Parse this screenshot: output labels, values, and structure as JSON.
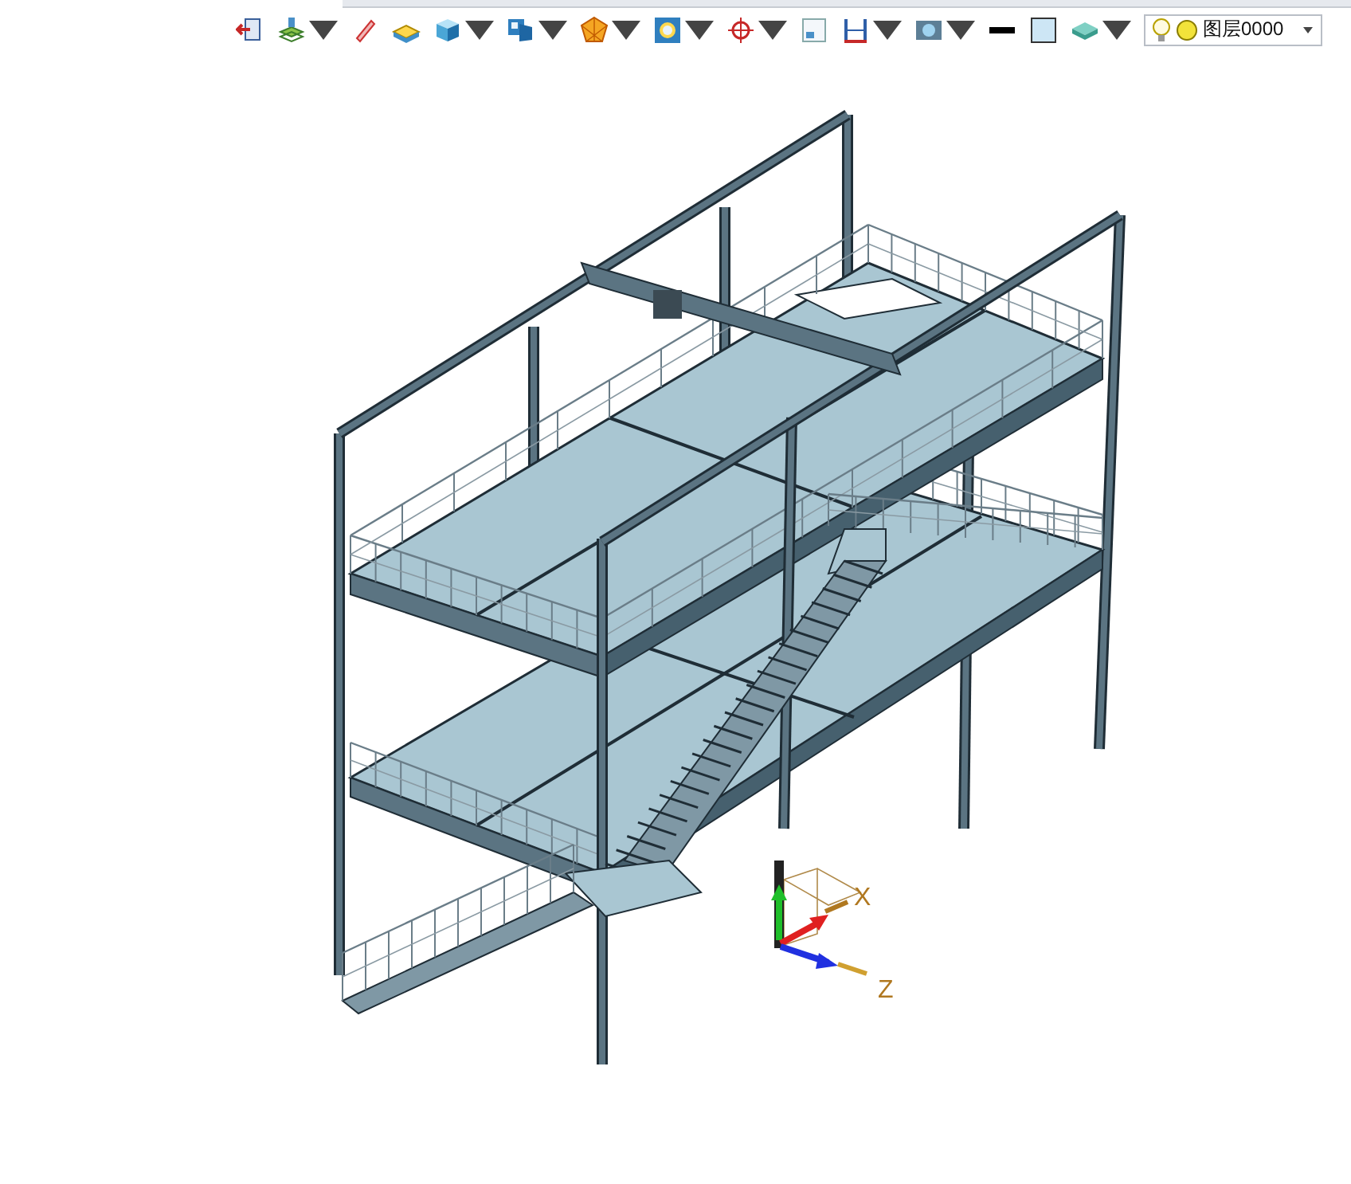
{
  "toolbar": {
    "buttons": [
      {
        "kind": "exit",
        "dropdown": false
      },
      {
        "kind": "layers",
        "dropdown": true
      },
      {
        "kind": "pen",
        "dropdown": false
      },
      {
        "kind": "face",
        "dropdown": false
      },
      {
        "kind": "cube",
        "dropdown": true
      },
      {
        "kind": "view",
        "dropdown": true
      },
      {
        "kind": "polygon",
        "dropdown": true
      },
      {
        "kind": "frame",
        "dropdown": true
      },
      {
        "kind": "target",
        "dropdown": true
      },
      {
        "kind": "window",
        "dropdown": false
      },
      {
        "kind": "dimension",
        "dropdown": true
      },
      {
        "kind": "render",
        "dropdown": true
      },
      {
        "kind": "line",
        "dropdown": false
      },
      {
        "kind": "fill",
        "dropdown": false
      },
      {
        "kind": "stack",
        "dropdown": true
      }
    ],
    "layer": {
      "value": "图层0000"
    }
  },
  "axes": {
    "x_label": "X",
    "z_label": "Z"
  }
}
